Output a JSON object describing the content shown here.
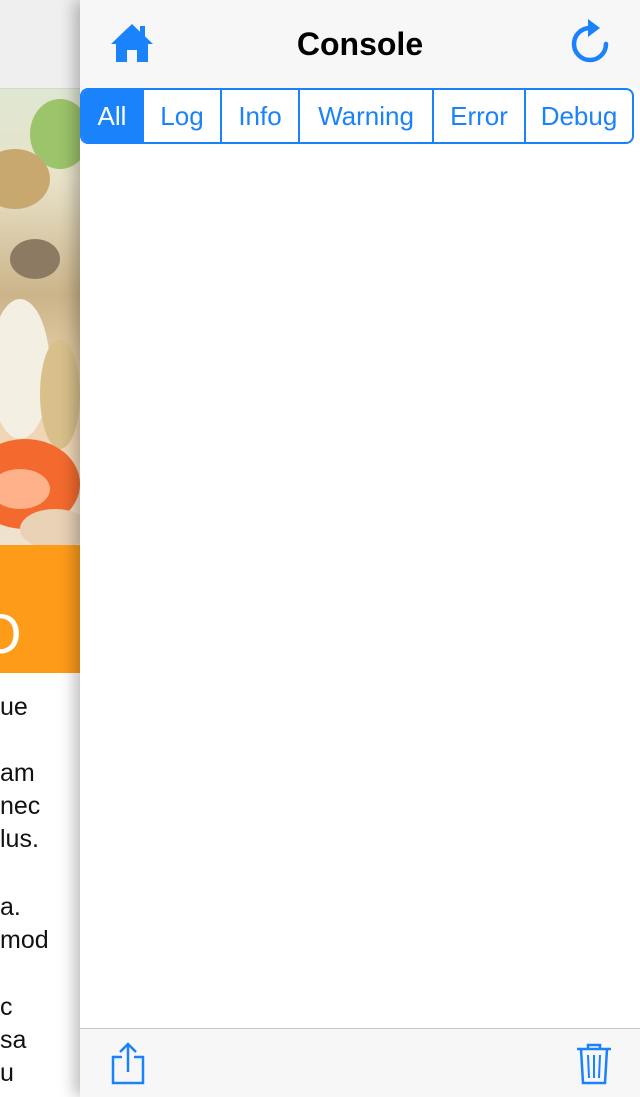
{
  "background_app": {
    "banner_text": "O",
    "body_lines": [
      "ue",
      "",
      "am",
      "nec",
      "lus.",
      "",
      "a.",
      "mod",
      "",
      "c",
      "sa",
      "u"
    ],
    "banner_color": "#fe9c1a"
  },
  "console": {
    "title": "Console",
    "accent_color": "#1a82fb",
    "nav": {
      "home_icon": "home-icon",
      "refresh_icon": "refresh-icon"
    },
    "filters": [
      {
        "label": "All",
        "active": true
      },
      {
        "label": "Log",
        "active": false
      },
      {
        "label": "Info",
        "active": false
      },
      {
        "label": "Warning",
        "active": false
      },
      {
        "label": "Error",
        "active": false
      },
      {
        "label": "Debug",
        "active": false
      }
    ],
    "entries": [],
    "toolbar": {
      "share_icon": "share-icon",
      "trash_icon": "trash-icon"
    }
  }
}
